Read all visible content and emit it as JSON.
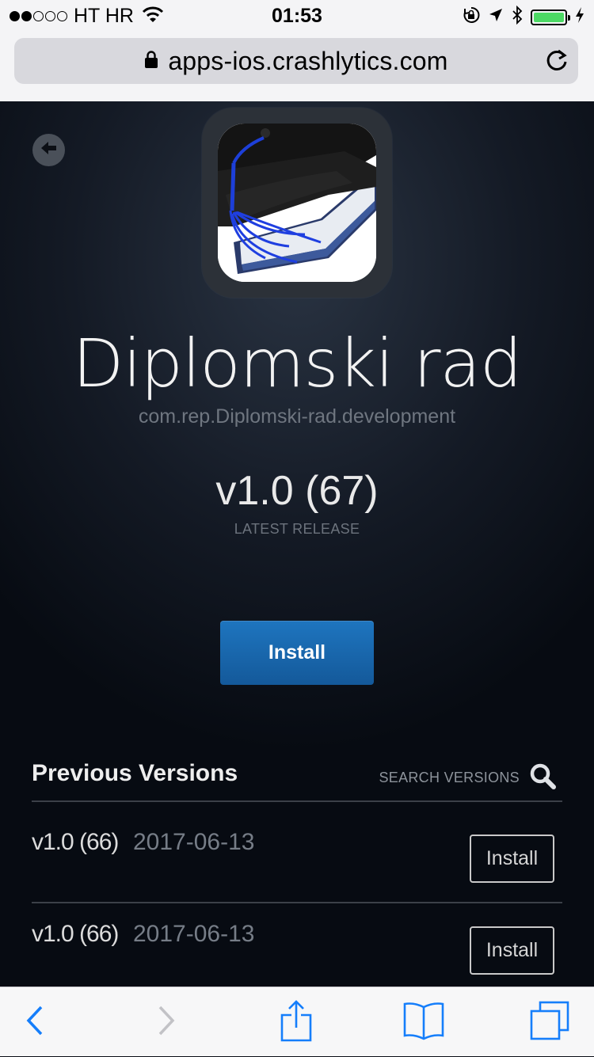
{
  "status_bar": {
    "signal_strength": 2,
    "signal_total": 5,
    "carrier": "HT HR",
    "time": "01:53",
    "battery_level": 1.0,
    "battery_color": "#4cd964",
    "icons": [
      "wifi-icon",
      "orientation-lock-icon",
      "location-icon",
      "bluetooth-icon",
      "battery-icon",
      "charging-icon"
    ]
  },
  "browser": {
    "url": "apps-ios.crashlytics.com",
    "icons": [
      "lock-icon",
      "reload-icon"
    ]
  },
  "app": {
    "title": "Diplomski rad",
    "bundle_id": "com.rep.Diplomski-rad.development",
    "version": "v1.0 (67)",
    "release_label": "LATEST RELEASE",
    "install_label": "Install",
    "accent_color": "#1a6db3"
  },
  "previous": {
    "title": "Previous Versions",
    "search_label": "SEARCH VERSIONS",
    "rows": [
      {
        "version": "v1.0 (66)",
        "date": "2017-06-13",
        "install_label": "Install"
      },
      {
        "version": "v1.0 (66)",
        "date": "2017-06-13",
        "install_label": "Install"
      }
    ]
  },
  "toolbar": {
    "items": [
      "back-icon",
      "forward-icon",
      "share-icon",
      "bookmarks-icon",
      "tabs-icon"
    ],
    "accent_color": "#157efb"
  }
}
